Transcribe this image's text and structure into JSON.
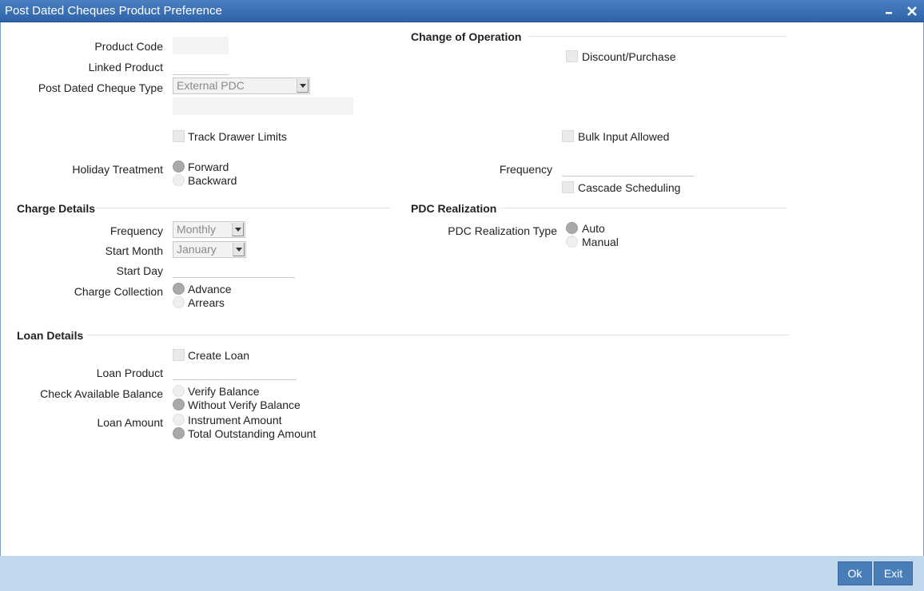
{
  "window": {
    "title": "Post Dated Cheques Product Preference"
  },
  "main": {
    "product_code_label": "Product Code",
    "linked_product_label": "Linked Product",
    "pdc_type_label": "Post Dated Cheque Type",
    "pdc_type_value": "External PDC",
    "track_drawer_limits_label": "Track Drawer Limits",
    "holiday_treatment_label": "Holiday Treatment",
    "holiday_forward": "Forward",
    "holiday_backward": "Backward"
  },
  "change_of_operation": {
    "heading": "Change of Operation",
    "discount_purchase": "Discount/Purchase",
    "bulk_input_allowed": "Bulk Input Allowed",
    "frequency_label": "Frequency",
    "cascade_scheduling": "Cascade Scheduling"
  },
  "charge_details": {
    "heading": "Charge Details",
    "frequency_label": "Frequency",
    "frequency_value": "Monthly",
    "start_month_label": "Start Month",
    "start_month_value": "January",
    "start_day_label": "Start Day",
    "charge_collection_label": "Charge Collection",
    "advance": "Advance",
    "arrears": "Arrears"
  },
  "pdc_realization": {
    "heading": "PDC Realization",
    "type_label": "PDC Realization Type",
    "auto": "Auto",
    "manual": "Manual"
  },
  "loan_details": {
    "heading": "Loan Details",
    "create_loan": "Create Loan",
    "loan_product_label": "Loan Product",
    "check_balance_label": "Check Available Balance",
    "verify_balance": "Verify Balance",
    "without_verify_balance": "Without Verify Balance",
    "loan_amount_label": "Loan Amount",
    "instrument_amount": "Instrument Amount",
    "total_outstanding_amount": "Total Outstanding Amount"
  },
  "footer": {
    "ok_label": "Ok",
    "exit_label": "Exit"
  },
  "colors": {
    "titlebar": "#2f63a8",
    "footer": "#c1d7ec",
    "button": "#4a7eb9"
  }
}
